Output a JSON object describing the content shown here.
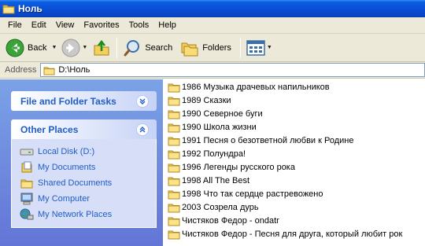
{
  "window": {
    "title": "Ноль"
  },
  "menu": [
    "File",
    "Edit",
    "View",
    "Favorites",
    "Tools",
    "Help"
  ],
  "toolbar": {
    "back_label": "Back",
    "search_label": "Search",
    "folders_label": "Folders"
  },
  "address": {
    "label": "Address",
    "value": "D:\\Ноль"
  },
  "tasks": {
    "file_folder_tasks": "File and Folder Tasks",
    "other_places": "Other Places",
    "places": [
      {
        "label": "Local Disk (D:)",
        "icon": "local-disk-icon"
      },
      {
        "label": "My Documents",
        "icon": "my-documents-icon"
      },
      {
        "label": "Shared Documents",
        "icon": "shared-documents-icon"
      },
      {
        "label": "My Computer",
        "icon": "my-computer-icon"
      },
      {
        "label": "My Network Places",
        "icon": "my-network-places-icon"
      }
    ]
  },
  "files": [
    "1986 Музыка драчевых напильников",
    "1989 Сказки",
    "1990 Северное буги",
    "1990 Школа жизни",
    "1991 Песня о безответной любви к Родине",
    "1992 Полундра!",
    "1996 Легенды русского рока",
    "1998 All The Best",
    "1998 Что так сердце растревожено",
    "2003 Созрела дурь",
    "Чистяков Федор -  ondatr",
    "Чистяков Федор -  Песня для друга, который любит рок"
  ],
  "colors": {
    "title_bar": "#0a4fd6",
    "task_pane": "#6f8ee0",
    "link_blue": "#215dc6",
    "chrome": "#ece9d8"
  }
}
